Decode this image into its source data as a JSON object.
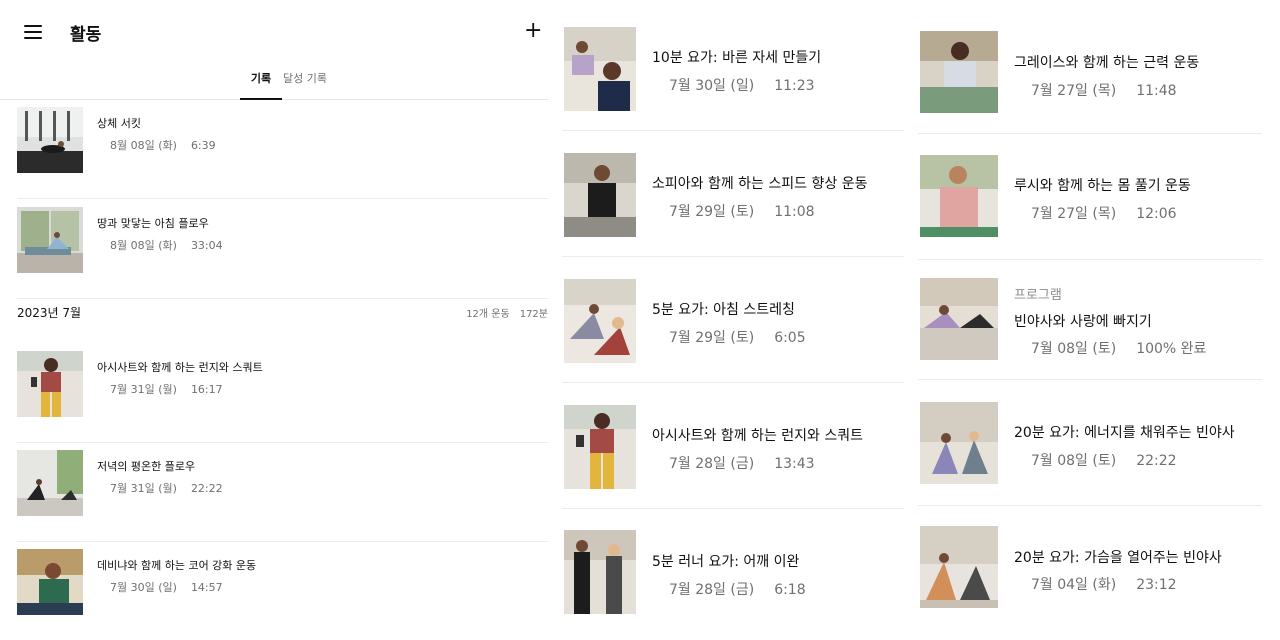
{
  "header": {
    "title": "활동",
    "menu_icon": "hamburger-menu-icon",
    "add_icon": "plus-icon"
  },
  "tabs": [
    {
      "label": "기록",
      "active": true
    },
    {
      "label": "달성 기록",
      "active": false
    }
  ],
  "recent": [
    {
      "title": "상체 서킷",
      "date": "8월 08일 (화)",
      "time": "6:39"
    },
    {
      "title": "땅과 맞닿는 아침 플로우",
      "date": "8월 08일 (화)",
      "time": "33:04"
    }
  ],
  "month": {
    "label": "2023년 7월",
    "workouts": "12개 운동",
    "minutes": "172분"
  },
  "july_left": [
    {
      "title": "아시사트와 함께 하는 런지와 스쿼트",
      "date": "7월 31일 (월)",
      "time": "16:17"
    },
    {
      "title": "저녁의 평온한 플로우",
      "date": "7월 31일 (월)",
      "time": "22:22"
    },
    {
      "title": "데비냐와 함께 하는 코어 강화 운동",
      "date": "7월 30일 (일)",
      "time": "14:57"
    }
  ],
  "middle": [
    {
      "title": "10분 요가: 바른 자세 만들기",
      "date": "7월 30일 (일)",
      "time": "11:23"
    },
    {
      "title": "소피아와 함께 하는 스피드 향상 운동",
      "date": "7월 29일 (토)",
      "time": "11:08"
    },
    {
      "title": "5분 요가: 아침 스트레칭",
      "date": "7월 29일 (토)",
      "time": "6:05"
    },
    {
      "title": "아시사트와 함께 하는 런지와 스쿼트",
      "date": "7월 28일 (금)",
      "time": "13:43"
    },
    {
      "title": "5분 러너 요가: 어깨 이완",
      "date": "7월 28일 (금)",
      "time": "6:18"
    }
  ],
  "right": [
    {
      "tag": "",
      "title": "그레이스와 함께 하는 근력 운동",
      "date": "7월 27일 (목)",
      "time": "11:48"
    },
    {
      "tag": "",
      "title": "루시와 함께 하는 몸 풀기 운동",
      "date": "7월 27일 (목)",
      "time": "12:06"
    },
    {
      "tag": "프로그램",
      "title": "빈야사와 사랑에 빠지기",
      "date": "7월 08일 (토)",
      "time": "100% 완료"
    },
    {
      "tag": "",
      "title": "20분 요가: 에너지를 채워주는 빈야사",
      "date": "7월 08일 (토)",
      "time": "22:22"
    },
    {
      "tag": "",
      "title": "20분 요가: 가슴을 열어주는 빈야사",
      "date": "7월 04일 (화)",
      "time": "23:12"
    }
  ],
  "colors": {
    "text": "#111111",
    "secondary": "#707072",
    "divider": "#ececec"
  }
}
